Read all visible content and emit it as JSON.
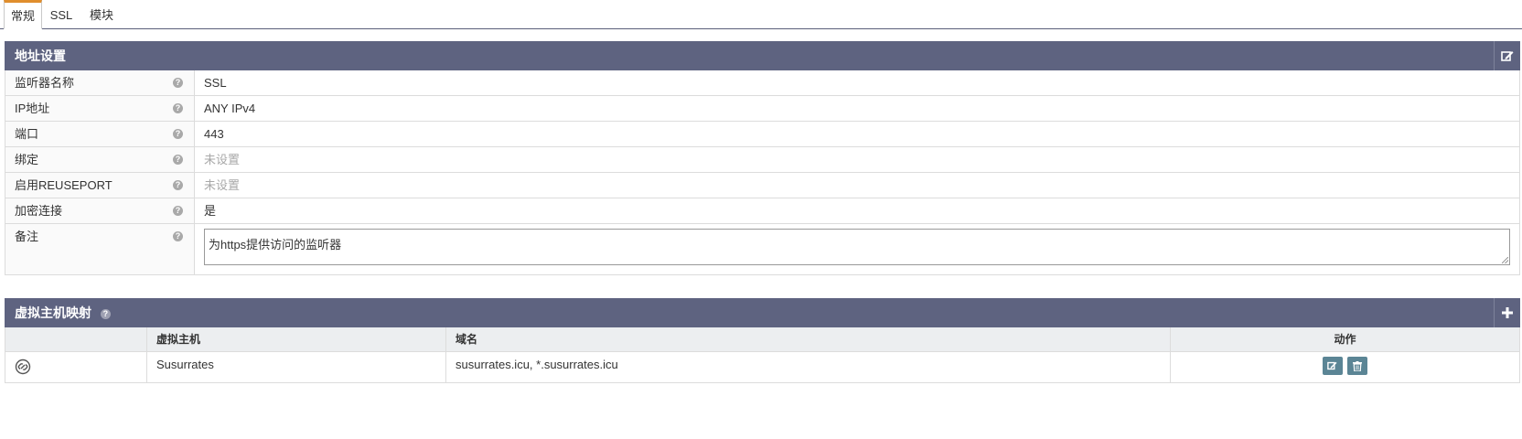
{
  "tabs": [
    {
      "label": "常规",
      "active": true
    },
    {
      "label": "SSL",
      "active": false
    },
    {
      "label": "模块",
      "active": false
    }
  ],
  "address": {
    "title": "地址设置",
    "rows": [
      {
        "label": "监听器名称",
        "value": "SSL",
        "unset": false
      },
      {
        "label": "IP地址",
        "value": "ANY IPv4",
        "unset": false
      },
      {
        "label": "端口",
        "value": "443",
        "unset": false
      },
      {
        "label": "绑定",
        "value": "未设置",
        "unset": true
      },
      {
        "label": "启用REUSEPORT",
        "value": "未设置",
        "unset": true
      },
      {
        "label": "加密连接",
        "value": "是",
        "unset": false
      }
    ],
    "note_label": "备注",
    "note_value": "为https提供访问的监听器"
  },
  "vhmap": {
    "title": "虚拟主机映射",
    "columns": [
      "",
      "虚拟主机",
      "域名",
      "动作"
    ],
    "rows": [
      {
        "vhost": "Susurrates",
        "domains": "susurrates.icu, *.susurrates.icu"
      }
    ]
  },
  "icons": {
    "edit": "edit-icon",
    "add": "plus-icon",
    "help": "help-icon",
    "link": "link-icon",
    "delete": "trash-icon"
  },
  "colors": {
    "header_bg": "#5e6380",
    "tab_accent": "#e08e2d",
    "action_btn": "#5b8595",
    "unset_text": "#a8a8a8"
  }
}
